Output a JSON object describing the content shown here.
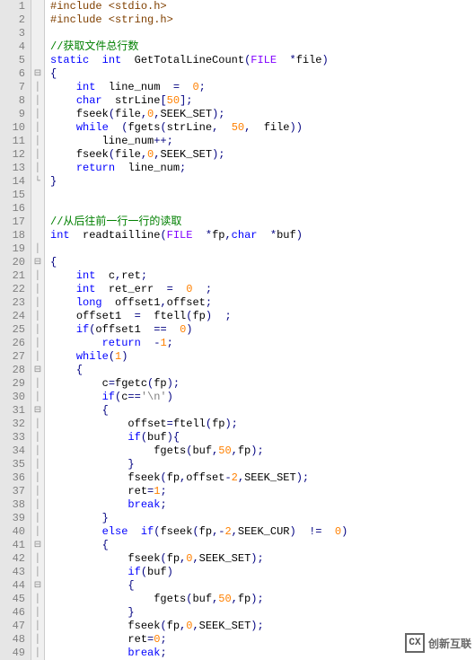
{
  "lines": [
    {
      "n": 1,
      "fold": "",
      "indent": 0,
      "tokens": [
        [
          "pp",
          "#include <stdio.h>"
        ]
      ]
    },
    {
      "n": 2,
      "fold": "",
      "indent": 0,
      "tokens": [
        [
          "pp",
          "#include <string.h>"
        ]
      ]
    },
    {
      "n": 3,
      "fold": "",
      "indent": 0,
      "tokens": []
    },
    {
      "n": 4,
      "fold": "",
      "indent": 0,
      "tokens": [
        [
          "cm",
          "//获取文件总行数"
        ]
      ]
    },
    {
      "n": 5,
      "fold": "",
      "indent": 0,
      "tokens": [
        [
          "kw",
          "static"
        ],
        [
          "",
          "  "
        ],
        [
          "kw",
          "int"
        ],
        [
          "",
          "  "
        ],
        [
          "id",
          "GetTotalLineCount"
        ],
        [
          "br",
          "("
        ],
        [
          "ty",
          "FILE"
        ],
        [
          "",
          "  "
        ],
        [
          "op",
          "*"
        ],
        [
          "id",
          "file"
        ],
        [
          "br",
          ")"
        ]
      ]
    },
    {
      "n": 6,
      "fold": "⊟",
      "indent": 0,
      "tokens": [
        [
          "br",
          "{"
        ]
      ]
    },
    {
      "n": 7,
      "fold": "│",
      "indent": 2,
      "tokens": [
        [
          "kw",
          "int"
        ],
        [
          "",
          "  "
        ],
        [
          "id",
          "line_num"
        ],
        [
          "",
          "  "
        ],
        [
          "op",
          "="
        ],
        [
          "",
          "  "
        ],
        [
          "num",
          "0"
        ],
        [
          "op",
          ";"
        ]
      ]
    },
    {
      "n": 8,
      "fold": "│",
      "indent": 2,
      "tokens": [
        [
          "kw",
          "char"
        ],
        [
          "",
          "  "
        ],
        [
          "id",
          "strLine"
        ],
        [
          "br",
          "["
        ],
        [
          "num",
          "50"
        ],
        [
          "br",
          "]"
        ],
        [
          "op",
          ";"
        ]
      ]
    },
    {
      "n": 9,
      "fold": "│",
      "indent": 2,
      "tokens": [
        [
          "id",
          "fseek"
        ],
        [
          "br",
          "("
        ],
        [
          "id",
          "file"
        ],
        [
          "op",
          ","
        ],
        [
          "num",
          "0"
        ],
        [
          "op",
          ","
        ],
        [
          "id",
          "SEEK_SET"
        ],
        [
          "br",
          ")"
        ],
        [
          "op",
          ";"
        ]
      ]
    },
    {
      "n": 10,
      "fold": "│",
      "indent": 2,
      "tokens": [
        [
          "kw",
          "while"
        ],
        [
          "",
          "  "
        ],
        [
          "br",
          "("
        ],
        [
          "id",
          "fgets"
        ],
        [
          "br",
          "("
        ],
        [
          "id",
          "strLine"
        ],
        [
          "op",
          ","
        ],
        [
          "",
          "  "
        ],
        [
          "num",
          "50"
        ],
        [
          "op",
          ","
        ],
        [
          "",
          "  "
        ],
        [
          "id",
          "file"
        ],
        [
          "br",
          "))"
        ]
      ]
    },
    {
      "n": 11,
      "fold": "│",
      "indent": 4,
      "tokens": [
        [
          "id",
          "line_num"
        ],
        [
          "op",
          "++;"
        ]
      ]
    },
    {
      "n": 12,
      "fold": "│",
      "indent": 2,
      "tokens": [
        [
          "id",
          "fseek"
        ],
        [
          "br",
          "("
        ],
        [
          "id",
          "file"
        ],
        [
          "op",
          ","
        ],
        [
          "num",
          "0"
        ],
        [
          "op",
          ","
        ],
        [
          "id",
          "SEEK_SET"
        ],
        [
          "br",
          ")"
        ],
        [
          "op",
          ";"
        ]
      ]
    },
    {
      "n": 13,
      "fold": "│",
      "indent": 2,
      "tokens": [
        [
          "kw",
          "return"
        ],
        [
          "",
          "  "
        ],
        [
          "id",
          "line_num"
        ],
        [
          "op",
          ";"
        ]
      ]
    },
    {
      "n": 14,
      "fold": "└",
      "indent": 0,
      "tokens": [
        [
          "br",
          "}"
        ]
      ]
    },
    {
      "n": 15,
      "fold": "",
      "indent": 0,
      "tokens": []
    },
    {
      "n": 16,
      "fold": "",
      "indent": 0,
      "tokens": []
    },
    {
      "n": 17,
      "fold": "",
      "indent": 0,
      "tokens": [
        [
          "cm",
          "//从后往前一行一行的读取"
        ]
      ]
    },
    {
      "n": 18,
      "fold": "",
      "indent": 0,
      "tokens": [
        [
          "kw",
          "int"
        ],
        [
          "",
          "  "
        ],
        [
          "id",
          "readtailline"
        ],
        [
          "br",
          "("
        ],
        [
          "ty",
          "FILE"
        ],
        [
          "",
          "  "
        ],
        [
          "op",
          "*"
        ],
        [
          "id",
          "fp"
        ],
        [
          "op",
          ","
        ],
        [
          "kw",
          "char"
        ],
        [
          "",
          "  "
        ],
        [
          "op",
          "*"
        ],
        [
          "id",
          "buf"
        ],
        [
          "br",
          ")"
        ]
      ]
    },
    {
      "n": 19,
      "fold": "│",
      "indent": 0,
      "tokens": []
    },
    {
      "n": 20,
      "fold": "⊟",
      "indent": 0,
      "tokens": [
        [
          "br",
          "{"
        ]
      ]
    },
    {
      "n": 21,
      "fold": "│",
      "indent": 2,
      "tokens": [
        [
          "kw",
          "int"
        ],
        [
          "",
          "  "
        ],
        [
          "id",
          "c"
        ],
        [
          "op",
          ","
        ],
        [
          "id",
          "ret"
        ],
        [
          "op",
          ";"
        ]
      ]
    },
    {
      "n": 22,
      "fold": "│",
      "indent": 2,
      "tokens": [
        [
          "kw",
          "int"
        ],
        [
          "",
          "  "
        ],
        [
          "id",
          "ret_err"
        ],
        [
          "",
          "  "
        ],
        [
          "op",
          "="
        ],
        [
          "",
          "  "
        ],
        [
          "num",
          "0"
        ],
        [
          "",
          "  "
        ],
        [
          "op",
          ";"
        ]
      ]
    },
    {
      "n": 23,
      "fold": "│",
      "indent": 2,
      "tokens": [
        [
          "kw",
          "long"
        ],
        [
          "",
          "  "
        ],
        [
          "id",
          "offset1"
        ],
        [
          "op",
          ","
        ],
        [
          "id",
          "offset"
        ],
        [
          "op",
          ";"
        ]
      ]
    },
    {
      "n": 24,
      "fold": "│",
      "indent": 2,
      "tokens": [
        [
          "id",
          "offset1"
        ],
        [
          "",
          "  "
        ],
        [
          "op",
          "="
        ],
        [
          "",
          "  "
        ],
        [
          "id",
          "ftell"
        ],
        [
          "br",
          "("
        ],
        [
          "id",
          "fp"
        ],
        [
          "br",
          ")"
        ],
        [
          "",
          "  "
        ],
        [
          "op",
          ";"
        ]
      ]
    },
    {
      "n": 25,
      "fold": "│",
      "indent": 2,
      "tokens": [
        [
          "kw",
          "if"
        ],
        [
          "br",
          "("
        ],
        [
          "id",
          "offset1"
        ],
        [
          "",
          "  "
        ],
        [
          "op",
          "=="
        ],
        [
          "",
          "  "
        ],
        [
          "num",
          "0"
        ],
        [
          "br",
          ")"
        ]
      ]
    },
    {
      "n": 26,
      "fold": "│",
      "indent": 4,
      "tokens": [
        [
          "kw",
          "return"
        ],
        [
          "",
          "  "
        ],
        [
          "op",
          "-"
        ],
        [
          "num",
          "1"
        ],
        [
          "op",
          ";"
        ]
      ]
    },
    {
      "n": 27,
      "fold": "│",
      "indent": 2,
      "tokens": [
        [
          "kw",
          "while"
        ],
        [
          "br",
          "("
        ],
        [
          "num",
          "1"
        ],
        [
          "br",
          ")"
        ]
      ]
    },
    {
      "n": 28,
      "fold": "⊟",
      "indent": 2,
      "tokens": [
        [
          "br",
          "{"
        ]
      ]
    },
    {
      "n": 29,
      "fold": "│",
      "indent": 4,
      "tokens": [
        [
          "id",
          "c"
        ],
        [
          "op",
          "="
        ],
        [
          "id",
          "fgetc"
        ],
        [
          "br",
          "("
        ],
        [
          "id",
          "fp"
        ],
        [
          "br",
          ")"
        ],
        [
          "op",
          ";"
        ]
      ]
    },
    {
      "n": 30,
      "fold": "│",
      "indent": 4,
      "tokens": [
        [
          "kw",
          "if"
        ],
        [
          "br",
          "("
        ],
        [
          "id",
          "c"
        ],
        [
          "op",
          "=="
        ],
        [
          "str",
          "'\\n'"
        ],
        [
          "br",
          ")"
        ]
      ]
    },
    {
      "n": 31,
      "fold": "⊟",
      "indent": 4,
      "tokens": [
        [
          "br",
          "{"
        ]
      ]
    },
    {
      "n": 32,
      "fold": "│",
      "indent": 6,
      "tokens": [
        [
          "id",
          "offset"
        ],
        [
          "op",
          "="
        ],
        [
          "id",
          "ftell"
        ],
        [
          "br",
          "("
        ],
        [
          "id",
          "fp"
        ],
        [
          "br",
          ")"
        ],
        [
          "op",
          ";"
        ]
      ]
    },
    {
      "n": 33,
      "fold": "│",
      "indent": 6,
      "tokens": [
        [
          "kw",
          "if"
        ],
        [
          "br",
          "("
        ],
        [
          "id",
          "buf"
        ],
        [
          "br",
          ")"
        ],
        [
          "br",
          "{"
        ]
      ]
    },
    {
      "n": 34,
      "fold": "│",
      "indent": 8,
      "tokens": [
        [
          "id",
          "fgets"
        ],
        [
          "br",
          "("
        ],
        [
          "id",
          "buf"
        ],
        [
          "op",
          ","
        ],
        [
          "num",
          "50"
        ],
        [
          "op",
          ","
        ],
        [
          "id",
          "fp"
        ],
        [
          "br",
          ")"
        ],
        [
          "op",
          ";"
        ]
      ]
    },
    {
      "n": 35,
      "fold": "│",
      "indent": 6,
      "tokens": [
        [
          "br",
          "}"
        ]
      ]
    },
    {
      "n": 36,
      "fold": "│",
      "indent": 6,
      "tokens": [
        [
          "id",
          "fseek"
        ],
        [
          "br",
          "("
        ],
        [
          "id",
          "fp"
        ],
        [
          "op",
          ","
        ],
        [
          "id",
          "offset"
        ],
        [
          "op",
          "-"
        ],
        [
          "num",
          "2"
        ],
        [
          "op",
          ","
        ],
        [
          "id",
          "SEEK_SET"
        ],
        [
          "br",
          ")"
        ],
        [
          "op",
          ";"
        ]
      ]
    },
    {
      "n": 37,
      "fold": "│",
      "indent": 6,
      "tokens": [
        [
          "id",
          "ret"
        ],
        [
          "op",
          "="
        ],
        [
          "num",
          "1"
        ],
        [
          "op",
          ";"
        ]
      ]
    },
    {
      "n": 38,
      "fold": "│",
      "indent": 6,
      "tokens": [
        [
          "kw",
          "break"
        ],
        [
          "op",
          ";"
        ]
      ]
    },
    {
      "n": 39,
      "fold": "│",
      "indent": 4,
      "tokens": [
        [
          "br",
          "}"
        ]
      ]
    },
    {
      "n": 40,
      "fold": "│",
      "indent": 4,
      "tokens": [
        [
          "kw",
          "else"
        ],
        [
          "",
          "  "
        ],
        [
          "kw",
          "if"
        ],
        [
          "br",
          "("
        ],
        [
          "id",
          "fseek"
        ],
        [
          "br",
          "("
        ],
        [
          "id",
          "fp"
        ],
        [
          "op",
          ","
        ],
        [
          "op",
          "-"
        ],
        [
          "num",
          "2"
        ],
        [
          "op",
          ","
        ],
        [
          "id",
          "SEEK_CUR"
        ],
        [
          "br",
          ")"
        ],
        [
          "",
          "  "
        ],
        [
          "op",
          "!="
        ],
        [
          "",
          "  "
        ],
        [
          "num",
          "0"
        ],
        [
          "br",
          ")"
        ]
      ]
    },
    {
      "n": 41,
      "fold": "⊟",
      "indent": 4,
      "tokens": [
        [
          "br",
          "{"
        ]
      ]
    },
    {
      "n": 42,
      "fold": "│",
      "indent": 6,
      "tokens": [
        [
          "id",
          "fseek"
        ],
        [
          "br",
          "("
        ],
        [
          "id",
          "fp"
        ],
        [
          "op",
          ","
        ],
        [
          "num",
          "0"
        ],
        [
          "op",
          ","
        ],
        [
          "id",
          "SEEK_SET"
        ],
        [
          "br",
          ")"
        ],
        [
          "op",
          ";"
        ]
      ]
    },
    {
      "n": 43,
      "fold": "│",
      "indent": 6,
      "tokens": [
        [
          "kw",
          "if"
        ],
        [
          "br",
          "("
        ],
        [
          "id",
          "buf"
        ],
        [
          "br",
          ")"
        ]
      ]
    },
    {
      "n": 44,
      "fold": "⊟",
      "indent": 6,
      "tokens": [
        [
          "br",
          "{"
        ]
      ]
    },
    {
      "n": 45,
      "fold": "│",
      "indent": 8,
      "tokens": [
        [
          "id",
          "fgets"
        ],
        [
          "br",
          "("
        ],
        [
          "id",
          "buf"
        ],
        [
          "op",
          ","
        ],
        [
          "num",
          "50"
        ],
        [
          "op",
          ","
        ],
        [
          "id",
          "fp"
        ],
        [
          "br",
          ")"
        ],
        [
          "op",
          ";"
        ]
      ]
    },
    {
      "n": 46,
      "fold": "│",
      "indent": 6,
      "tokens": [
        [
          "br",
          "}"
        ]
      ]
    },
    {
      "n": 47,
      "fold": "│",
      "indent": 6,
      "tokens": [
        [
          "id",
          "fseek"
        ],
        [
          "br",
          "("
        ],
        [
          "id",
          "fp"
        ],
        [
          "op",
          ","
        ],
        [
          "num",
          "0"
        ],
        [
          "op",
          ","
        ],
        [
          "id",
          "SEEK_SET"
        ],
        [
          "br",
          ")"
        ],
        [
          "op",
          ";"
        ]
      ]
    },
    {
      "n": 48,
      "fold": "│",
      "indent": 6,
      "tokens": [
        [
          "id",
          "ret"
        ],
        [
          "op",
          "="
        ],
        [
          "num",
          "0"
        ],
        [
          "op",
          ";"
        ]
      ]
    },
    {
      "n": 49,
      "fold": "│",
      "indent": 6,
      "tokens": [
        [
          "kw",
          "break"
        ],
        [
          "op",
          ";"
        ]
      ]
    }
  ],
  "logo": {
    "mark": "CX",
    "text": "创新互联"
  }
}
